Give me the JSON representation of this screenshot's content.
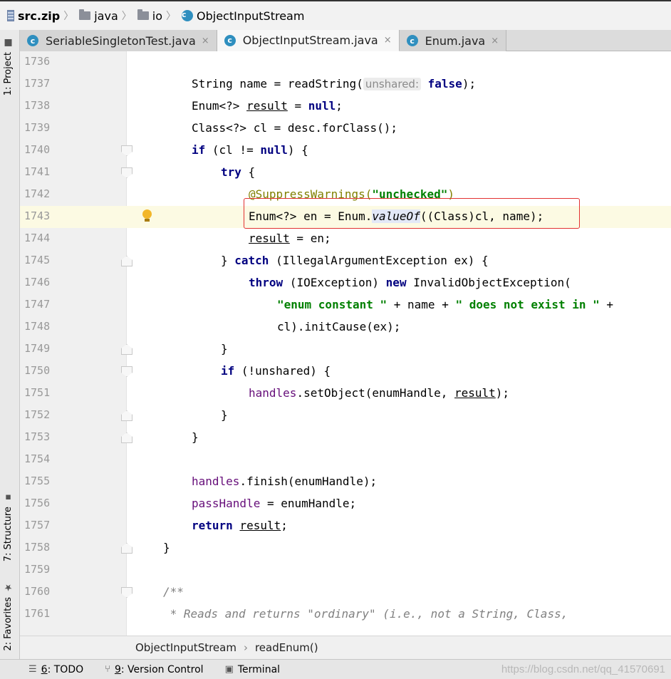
{
  "breadcrumb": {
    "root": "src.zip",
    "pkg1": "java",
    "pkg2": "io",
    "cls": "ObjectInputStream"
  },
  "side_tabs": {
    "project": "1: Project",
    "structure": "7: Structure",
    "favorites": "2: Favorites"
  },
  "tabs": [
    {
      "label": "SeriableSingletonTest.java",
      "close": "×"
    },
    {
      "label": "ObjectInputStream.java",
      "close": "×"
    },
    {
      "label": "Enum.java",
      "close": "×"
    }
  ],
  "code": {
    "l1737": {
      "a": "String name = readString(",
      "hint": "unshared:",
      "b": "false",
      "c": ");"
    },
    "l1738": {
      "a": "Enum<?> ",
      "b": "result",
      "c": " = ",
      "d": "null",
      "e": ";"
    },
    "l1739": "Class<?> cl = desc.forClass();",
    "l1740": {
      "a": "if",
      "b": " (cl != ",
      "c": "null",
      "d": ") {"
    },
    "l1741": {
      "a": "try",
      "b": " {"
    },
    "l1742": {
      "a": "@SuppressWarnings(",
      "b": "\"unchecked\"",
      "c": ")"
    },
    "l1743": {
      "a": "Enum<?> en = Enum.",
      "b": "valueOf",
      "c": "((Class)cl, name);"
    },
    "l1744": {
      "a": "result",
      "b": " = en;"
    },
    "l1745": {
      "a": "} ",
      "b": "catch",
      "c": " (IllegalArgumentException ex) {"
    },
    "l1746": {
      "a": "throw",
      "b": " (IOException) ",
      "c": "new",
      "d": " InvalidObjectException("
    },
    "l1747": {
      "a": "\"enum constant \"",
      "b": " + name + ",
      "c": "\" does not exist in \"",
      "d": " +"
    },
    "l1748": "cl).initCause(ex);",
    "l1749": "}",
    "l1750": {
      "a": "if",
      "b": " (!unshared) {"
    },
    "l1751": {
      "a": "handles",
      "b": ".setObject(enumHandle, ",
      "c": "result",
      "d": ");"
    },
    "l1752": "}",
    "l1753": "}",
    "l1755": {
      "a": "handles",
      "b": ".finish(enumHandle);"
    },
    "l1756": {
      "a": "passHandle",
      "b": " = enumHandle;"
    },
    "l1757": {
      "a": "return",
      "b": " ",
      "c": "result",
      "d": ";"
    },
    "l1758": "}",
    "l1760": "/**",
    "l1761": " * Reads and returns \"ordinary\" (i.e., not a String, Class,"
  },
  "code_breadcrumb": {
    "cls": "ObjectInputStream",
    "method": "readEnum()"
  },
  "tool_windows": {
    "todo_key": "6",
    "todo": ": TODO",
    "vcs_key": "9",
    "vcs": ": Version Control",
    "terminal": "Terminal"
  },
  "watermark": "https://blog.csdn.net/qq_41570691",
  "colors": {
    "keyword": "#000080",
    "string": "#008000",
    "field": "#660e7a",
    "annotation": "#808000",
    "highlight_line": "#fcfae3",
    "error_box": "#e23232"
  }
}
